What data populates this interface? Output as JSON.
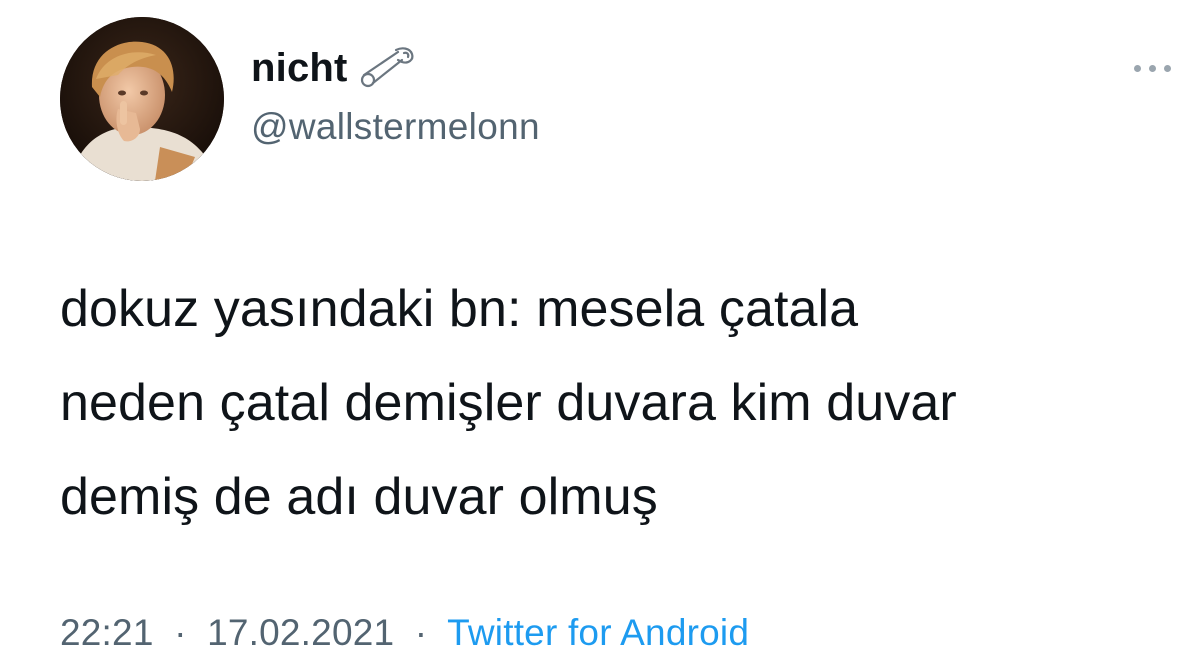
{
  "author": {
    "display_name": "nicht",
    "handle": "@wallstermelonn",
    "name_badge_icon": "safety-pin-icon",
    "avatar_icon": "profile-photo-avatar"
  },
  "more_icon": "more-horizontal-icon",
  "tweet": {
    "lines": [
      "dokuz yasındaki bn: mesela çatala",
      "neden çatal demişler duvara kim duvar",
      "demiş de adı duvar olmuş"
    ]
  },
  "meta": {
    "time": "22:21",
    "separator": "·",
    "date": "17.02.2021",
    "source": "Twitter for Android"
  },
  "colors": {
    "text": "#0f1419",
    "secondary": "#536471",
    "link": "#1d9bf0"
  }
}
